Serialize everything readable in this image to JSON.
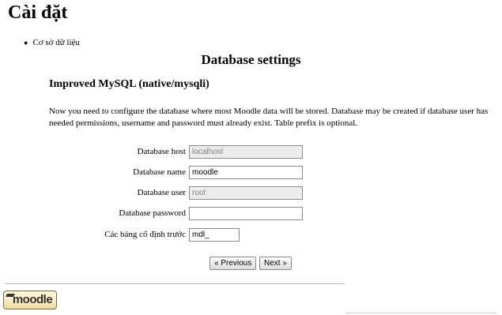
{
  "header": {
    "title": "Cài đặt"
  },
  "breadcrumb": {
    "item": "Cơ sở dữ liệu"
  },
  "section": {
    "title": "Database settings"
  },
  "driver": {
    "title": "Improved MySQL (native/mysqli)"
  },
  "description": "Now you need to configure the database where most Moodle data will be stored. Database may be created if database user has needed permissions, username and password must already exist. Table prefix is optional.",
  "form": {
    "dbhost": {
      "label": "Database host",
      "value": "localhost",
      "disabled": true
    },
    "dbname": {
      "label": "Database name",
      "value": "moodle",
      "disabled": false
    },
    "dbuser": {
      "label": "Database user",
      "value": "root",
      "disabled": true
    },
    "dbpass": {
      "label": "Database password",
      "value": "",
      "disabled": false
    },
    "prefix": {
      "label": "Các bảng cố định trước",
      "value": "mdl_",
      "disabled": false
    }
  },
  "buttons": {
    "previous": "« Previous",
    "next": "Next »"
  },
  "footer": {
    "logo": "moodle"
  },
  "icons": {
    "bullet": "bullet-icon",
    "logo_cap": "graduation-cap-icon"
  }
}
